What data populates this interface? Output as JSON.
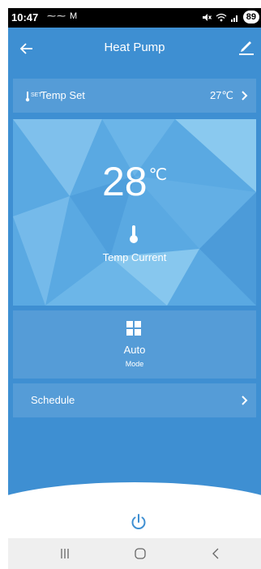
{
  "status_bar": {
    "time": "10:47",
    "notifications": "⁓⁓ M",
    "battery": "89"
  },
  "header": {
    "title": "Heat Pump"
  },
  "temp_set": {
    "prefix": "SET",
    "label": "Temp Set",
    "value": "27℃"
  },
  "current": {
    "temperature": "28",
    "unit": "℃",
    "label": "Temp Current"
  },
  "mode": {
    "value": "Auto",
    "label": "Mode"
  },
  "schedule": {
    "label": "Schedule"
  },
  "colors": {
    "screen_blue": "#3e8fd2",
    "panel_blue": "#5aa9e2",
    "power_icon": "#3e8fd2"
  }
}
